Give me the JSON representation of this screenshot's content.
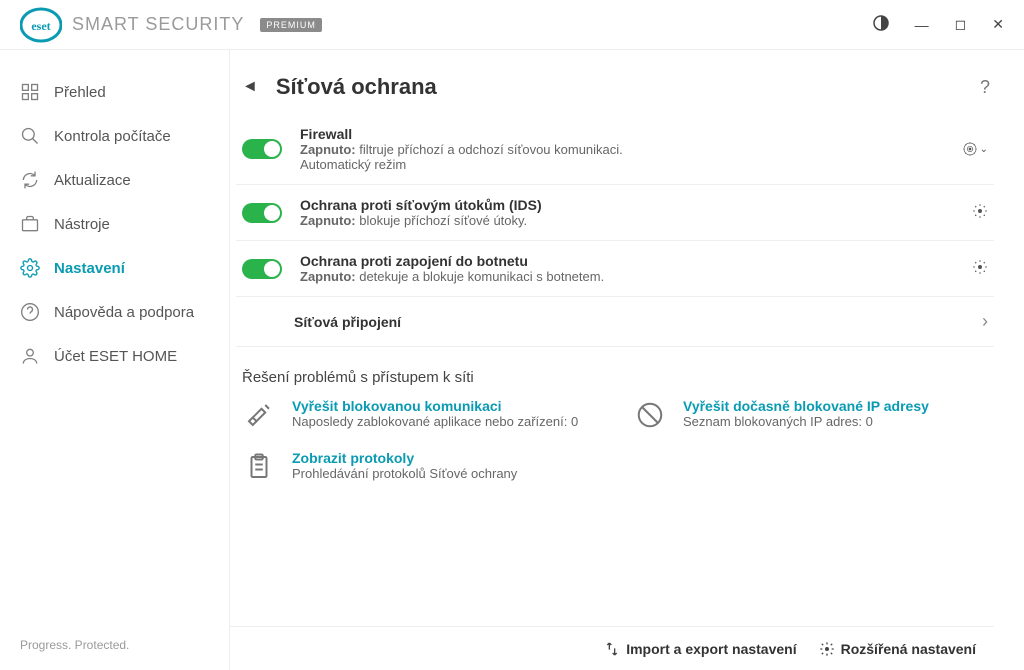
{
  "header": {
    "brand_prefix": "SMART ",
    "brand_suffix": "SECURITY",
    "premium": "PREMIUM"
  },
  "sidebar": {
    "items": [
      {
        "label": "Přehled"
      },
      {
        "label": "Kontrola počítače"
      },
      {
        "label": "Aktualizace"
      },
      {
        "label": "Nástroje"
      },
      {
        "label": "Nastavení"
      },
      {
        "label": "Nápověda a podpora"
      },
      {
        "label": "Účet ESET HOME"
      }
    ],
    "footer": "Progress. Protected."
  },
  "main": {
    "title": "Síťová ochrana",
    "settings": [
      {
        "title": "Firewall",
        "on_label": "Zapnuto:",
        "desc": "filtruje příchozí a odchozí síťovou komunikaci.",
        "extra": "Automatický režim"
      },
      {
        "title": "Ochrana proti síťovým útokům (IDS)",
        "on_label": "Zapnuto:",
        "desc": "blokuje příchozí síťové útoky."
      },
      {
        "title": "Ochrana proti zapojení do botnetu",
        "on_label": "Zapnuto:",
        "desc": "detekuje a blokuje komunikaci s botnetem."
      }
    ],
    "nav_row": "Síťová připojení",
    "section_heading": "Řešení problémů s přístupem k síti",
    "trouble": [
      {
        "title": "Vyřešit blokovanou komunikaci",
        "sub": "Naposledy zablokované aplikace nebo zařízení: 0"
      },
      {
        "title": "Vyřešit dočasně blokované IP adresy",
        "sub": "Seznam blokovaných IP adres: 0"
      },
      {
        "title": "Zobrazit protokoly",
        "sub": "Prohledávání protokolů Síťové ochrany"
      }
    ]
  },
  "bottom": {
    "import_export": "Import a export nastavení",
    "advanced": "Rozšířená nastavení"
  }
}
